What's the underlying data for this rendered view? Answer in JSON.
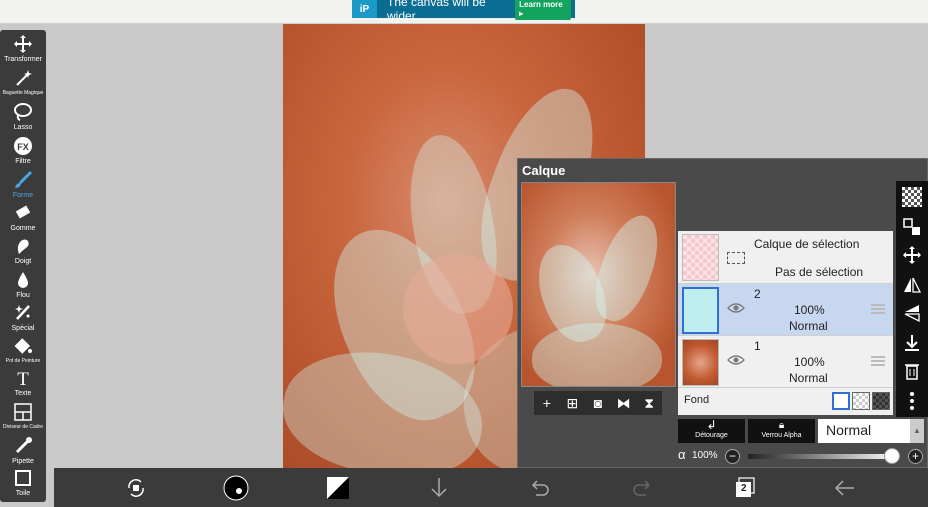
{
  "ad": {
    "text": "The canvas will be wider.",
    "button": "Learn more ▸",
    "logo": "iP"
  },
  "toolbar": {
    "tools": [
      {
        "label": "Transformer",
        "icon": "move-arrows-icon"
      },
      {
        "label": "Baguette Magique",
        "icon": "magic-wand-icon"
      },
      {
        "label": "Lasso",
        "icon": "lasso-icon"
      },
      {
        "label": "Filtre",
        "icon": "fx-filter-icon"
      },
      {
        "label": "Forme",
        "icon": "brush-icon"
      },
      {
        "label": "Gomme",
        "icon": "eraser-icon"
      },
      {
        "label": "Doigt",
        "icon": "smudge-finger-icon"
      },
      {
        "label": "Flou",
        "icon": "blur-drop-icon"
      },
      {
        "label": "Spécial",
        "icon": "special-brush-icon"
      },
      {
        "label": "Pot de Peinture",
        "icon": "paint-bucket-icon"
      },
      {
        "label": "Texte",
        "icon": "text-icon"
      },
      {
        "label": "Diviseur de Cadre",
        "icon": "frame-divider-icon"
      },
      {
        "label": "Pipette",
        "icon": "eyedropper-icon"
      },
      {
        "label": "Toile",
        "icon": "canvas-icon"
      }
    ],
    "active_index": 4
  },
  "layers_panel": {
    "title": "Calque",
    "selection_layer": {
      "title": "Calque de sélection",
      "status": "Pas de sélection"
    },
    "layers": [
      {
        "name": "2",
        "opacity": "100%",
        "mode": "Normal"
      },
      {
        "name": "1",
        "opacity": "100%",
        "mode": "Normal"
      }
    ],
    "background_label": "Fond",
    "clipping_label": "Détourage",
    "alpha_lock_label": "Verrou Alpha",
    "blend_mode": "Normal",
    "alpha_symbol": "α",
    "alpha_value": "100%"
  },
  "bottombar": {
    "layer_count": "2"
  },
  "colors": {
    "toolbar_bg": "#3b3b3b",
    "accent": "#4aa6e6",
    "canvas_orange": "#c0582f",
    "flower_cyan": "#c8f2ee"
  }
}
